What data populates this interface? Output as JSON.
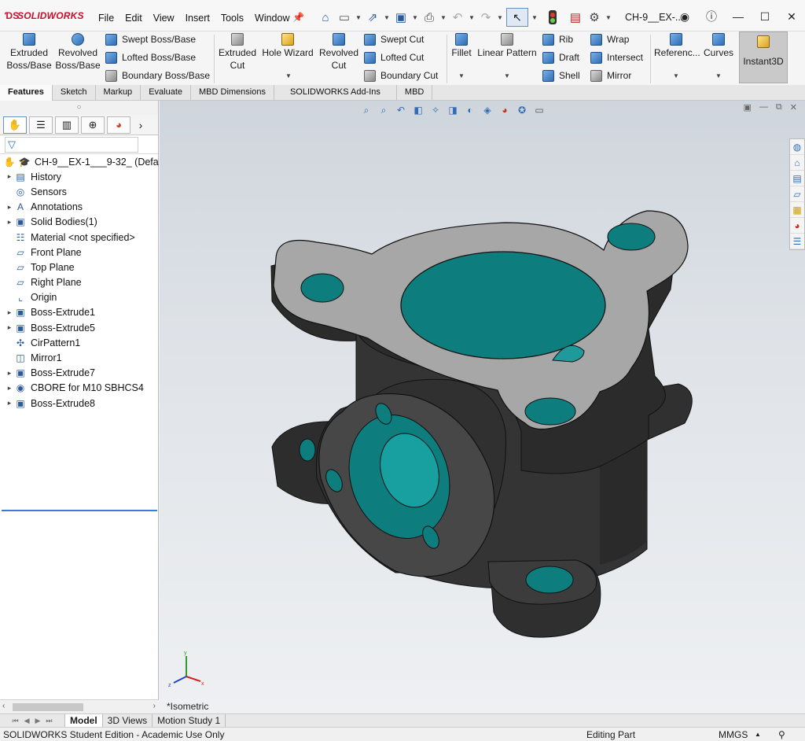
{
  "titlebar": {
    "logo": "SOLIDWORKS",
    "menus": [
      "File",
      "Edit",
      "View",
      "Insert",
      "Tools",
      "Window"
    ],
    "document_title": "CH-9__EX-..."
  },
  "ribbon": {
    "extruded_boss": [
      "Extruded",
      "Boss/Base"
    ],
    "revolved_boss": [
      "Revolved",
      "Boss/Base"
    ],
    "swept_boss": "Swept Boss/Base",
    "lofted_boss": "Lofted Boss/Base",
    "boundary_boss": "Boundary Boss/Base",
    "extruded_cut": [
      "Extruded",
      "Cut"
    ],
    "hole_wizard": "Hole Wizard",
    "revolved_cut": [
      "Revolved",
      "Cut"
    ],
    "swept_cut": "Swept Cut",
    "lofted_cut": "Lofted Cut",
    "boundary_cut": "Boundary Cut",
    "fillet": "Fillet",
    "linear_pattern": "Linear Pattern",
    "rib": "Rib",
    "draft": "Draft",
    "shell": "Shell",
    "wrap": "Wrap",
    "intersect": "Intersect",
    "mirror": "Mirror",
    "reference": "Referenc...",
    "curves": "Curves",
    "instant3d": "Instant3D"
  },
  "tabs": [
    "Features",
    "Sketch",
    "Markup",
    "Evaluate",
    "MBD Dimensions",
    "SOLIDWORKS Add-Ins",
    "MBD"
  ],
  "tree": {
    "root": "CH-9__EX-1___9-32_ (Defa",
    "items": [
      {
        "label": "History",
        "icon": "history-icon",
        "expand": true
      },
      {
        "label": "Sensors",
        "icon": "sensors-icon",
        "expand": false
      },
      {
        "label": "Annotations",
        "icon": "annotations-icon",
        "expand": true
      },
      {
        "label": "Solid Bodies(1)",
        "icon": "solid-bodies-icon",
        "expand": true
      },
      {
        "label": "Material <not specified>",
        "icon": "material-icon",
        "expand": false
      },
      {
        "label": "Front Plane",
        "icon": "plane-icon",
        "expand": false
      },
      {
        "label": "Top Plane",
        "icon": "plane-icon",
        "expand": false
      },
      {
        "label": "Right Plane",
        "icon": "plane-icon",
        "expand": false
      },
      {
        "label": "Origin",
        "icon": "origin-icon",
        "expand": false
      },
      {
        "label": "Boss-Extrude1",
        "icon": "extrude-icon",
        "expand": true
      },
      {
        "label": "Boss-Extrude5",
        "icon": "extrude-icon",
        "expand": true
      },
      {
        "label": "CirPattern1",
        "icon": "circular-pattern-icon",
        "expand": false
      },
      {
        "label": "Mirror1",
        "icon": "mirror-icon",
        "expand": false
      },
      {
        "label": "Boss-Extrude7",
        "icon": "extrude-icon",
        "expand": true
      },
      {
        "label": "CBORE for M10 SBHCS4",
        "icon": "hole-wizard-icon",
        "expand": true
      },
      {
        "label": "Boss-Extrude8",
        "icon": "extrude-icon",
        "expand": true
      }
    ]
  },
  "viewport": {
    "view_name": "*Isometric",
    "triad": {
      "x": "x",
      "y": "y",
      "z": "z"
    }
  },
  "bottom_tabs": [
    "Model",
    "3D Views",
    "Motion Study 1"
  ],
  "status": {
    "edition": "SOLIDWORKS Student Edition - Academic Use Only",
    "mode": "Editing Part",
    "units": "MMGS"
  },
  "colors": {
    "model_body": "#333333",
    "model_flange_top": "#a9a9a9",
    "hole_fill": "#0e7d7d",
    "background_top": "#cfd5dc",
    "logo": "#c8102e"
  }
}
